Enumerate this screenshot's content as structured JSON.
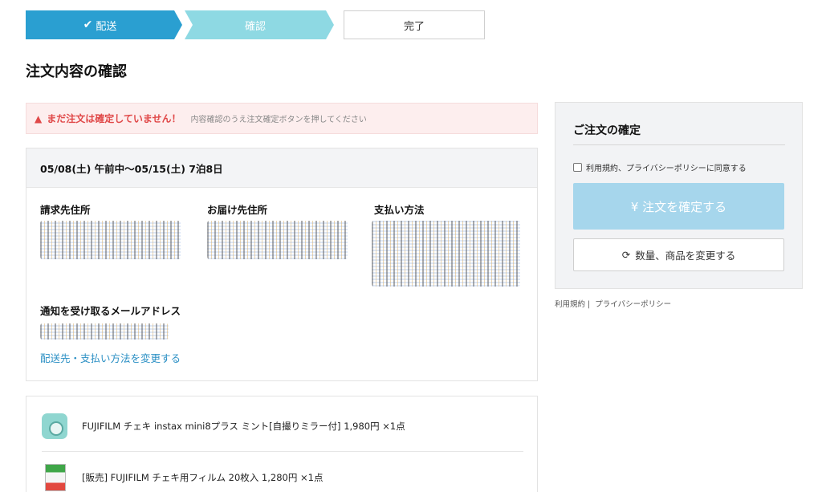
{
  "stepper": {
    "step1": "配送",
    "step2": "確認",
    "step3": "完了"
  },
  "page_title": "注文内容の確認",
  "alert": {
    "strong": "まだ注文は確定していません！",
    "sub": "内容確認のうえ注文確定ボタンを押してください"
  },
  "stay": {
    "period": "05/08(土) 午前中〜05/15(土) 7泊8日"
  },
  "info": {
    "billing_label": "請求先住所",
    "delivery_label": "お届け先住所",
    "payment_label": "支払い方法",
    "email_label": "通知を受け取るメールアドレス",
    "change_link": "配送先・支払い方法を変更する"
  },
  "products": [
    {
      "text": "FUJIFILM チェキ instax mini8プラス ミント[自撮りミラー付]  1,980円 ×1点"
    },
    {
      "text": "[販売] FUJIFILM チェキ用フィルム 20枚入  1,280円 ×1点"
    }
  ],
  "sidebar": {
    "title": "ご注文の確定",
    "agree_label": "利用規約、プライバシーポリシーに同意する",
    "confirm_label": "¥ 注文を確定する",
    "change_label": "数量、商品を変更する"
  },
  "footer": {
    "terms": "利用規約",
    "sep": "|",
    "privacy": "プライバシーポリシー"
  },
  "colors": {
    "primary": "#2a9fd1",
    "secondary_step": "#8ed9e3",
    "alert_bg": "#fdeeee",
    "alert_text": "#e04848",
    "confirm_btn": "#a6d6ec",
    "link": "#2a8fc4"
  }
}
